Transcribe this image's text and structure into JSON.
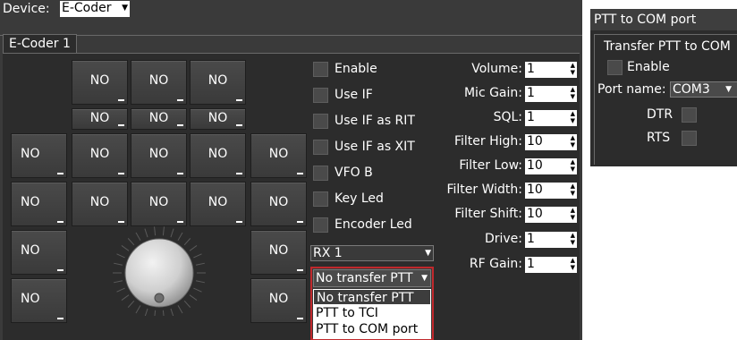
{
  "device_bar": {
    "label": "Device:",
    "device_value": "E-Coder"
  },
  "tab": {
    "label": "E-Coder 1"
  },
  "buttons": {
    "label": "NO"
  },
  "checkboxes": [
    {
      "label": "Enable",
      "checked": false
    },
    {
      "label": "Use IF",
      "checked": false
    },
    {
      "label": "Use IF as RIT",
      "checked": false
    },
    {
      "label": "Use IF as XIT",
      "checked": false
    },
    {
      "label": "VFO B",
      "checked": false
    },
    {
      "label": "Key Led",
      "checked": false
    },
    {
      "label": "Encoder Led",
      "checked": false
    }
  ],
  "rx_select": {
    "value": "RX 1"
  },
  "ptt_mode": {
    "selected": "No transfer PTT",
    "options": [
      "No transfer PTT",
      "PTT to TCI",
      "PTT to COM port"
    ]
  },
  "params": [
    {
      "label": "Volume:",
      "value": "1"
    },
    {
      "label": "Mic Gain:",
      "value": "1"
    },
    {
      "label": "SQL:",
      "value": "1"
    },
    {
      "label": "Filter High:",
      "value": "10"
    },
    {
      "label": "Filter Low:",
      "value": "10"
    },
    {
      "label": "Filter Width:",
      "value": "10"
    },
    {
      "label": "Filter Shift:",
      "value": "10"
    },
    {
      "label": "Drive:",
      "value": "1"
    },
    {
      "label": "RF Gain:",
      "value": "1"
    }
  ],
  "ptt_window": {
    "title": "PTT to COM port",
    "group_title": "Transfer PTT to COM",
    "enable_label": "Enable",
    "port_label": "Port name:",
    "port_value": "COM3",
    "dtr_label": "DTR",
    "rts_label": "RTS"
  },
  "colors": {
    "window_bg": "#3a3a3a",
    "panel_bg": "#2c2c2c",
    "highlight": "#c0282c"
  }
}
